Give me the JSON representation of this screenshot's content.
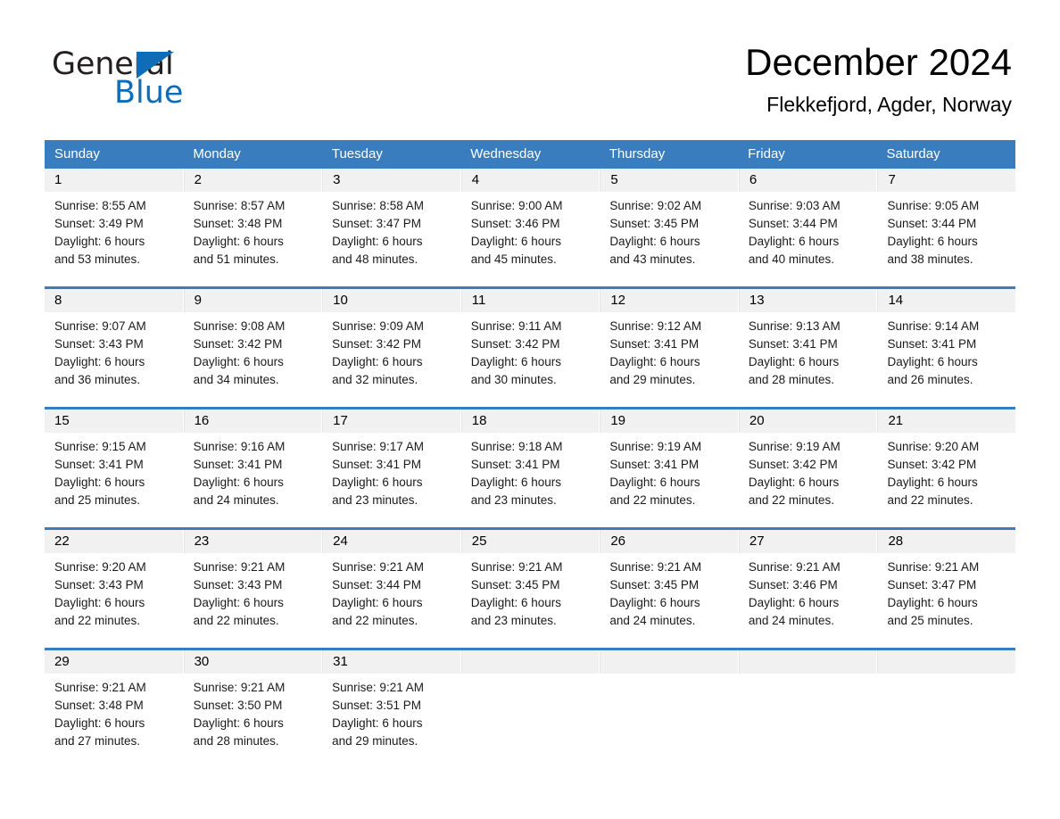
{
  "logo": {
    "word_one": "General",
    "word_two": "Blue",
    "triangle_icon": "triangle-icon",
    "brand_blue": "#0f6cb5"
  },
  "header": {
    "title": "December 2024",
    "subtitle": "Flekkefjord, Agder, Norway"
  },
  "colors": {
    "header_blue": "#3a7dbe",
    "day_band_gray": "#f1f1f1",
    "text_black": "#000000"
  },
  "weekdays": [
    "Sunday",
    "Monday",
    "Tuesday",
    "Wednesday",
    "Thursday",
    "Friday",
    "Saturday"
  ],
  "weeks": [
    {
      "days": [
        {
          "date": "1",
          "sunrise": "Sunrise: 8:55 AM",
          "sunset": "Sunset: 3:49 PM",
          "daylight_line1": "Daylight: 6 hours",
          "daylight_line2": "and 53 minutes."
        },
        {
          "date": "2",
          "sunrise": "Sunrise: 8:57 AM",
          "sunset": "Sunset: 3:48 PM",
          "daylight_line1": "Daylight: 6 hours",
          "daylight_line2": "and 51 minutes."
        },
        {
          "date": "3",
          "sunrise": "Sunrise: 8:58 AM",
          "sunset": "Sunset: 3:47 PM",
          "daylight_line1": "Daylight: 6 hours",
          "daylight_line2": "and 48 minutes."
        },
        {
          "date": "4",
          "sunrise": "Sunrise: 9:00 AM",
          "sunset": "Sunset: 3:46 PM",
          "daylight_line1": "Daylight: 6 hours",
          "daylight_line2": "and 45 minutes."
        },
        {
          "date": "5",
          "sunrise": "Sunrise: 9:02 AM",
          "sunset": "Sunset: 3:45 PM",
          "daylight_line1": "Daylight: 6 hours",
          "daylight_line2": "and 43 minutes."
        },
        {
          "date": "6",
          "sunrise": "Sunrise: 9:03 AM",
          "sunset": "Sunset: 3:44 PM",
          "daylight_line1": "Daylight: 6 hours",
          "daylight_line2": "and 40 minutes."
        },
        {
          "date": "7",
          "sunrise": "Sunrise: 9:05 AM",
          "sunset": "Sunset: 3:44 PM",
          "daylight_line1": "Daylight: 6 hours",
          "daylight_line2": "and 38 minutes."
        }
      ]
    },
    {
      "days": [
        {
          "date": "8",
          "sunrise": "Sunrise: 9:07 AM",
          "sunset": "Sunset: 3:43 PM",
          "daylight_line1": "Daylight: 6 hours",
          "daylight_line2": "and 36 minutes."
        },
        {
          "date": "9",
          "sunrise": "Sunrise: 9:08 AM",
          "sunset": "Sunset: 3:42 PM",
          "daylight_line1": "Daylight: 6 hours",
          "daylight_line2": "and 34 minutes."
        },
        {
          "date": "10",
          "sunrise": "Sunrise: 9:09 AM",
          "sunset": "Sunset: 3:42 PM",
          "daylight_line1": "Daylight: 6 hours",
          "daylight_line2": "and 32 minutes."
        },
        {
          "date": "11",
          "sunrise": "Sunrise: 9:11 AM",
          "sunset": "Sunset: 3:42 PM",
          "daylight_line1": "Daylight: 6 hours",
          "daylight_line2": "and 30 minutes."
        },
        {
          "date": "12",
          "sunrise": "Sunrise: 9:12 AM",
          "sunset": "Sunset: 3:41 PM",
          "daylight_line1": "Daylight: 6 hours",
          "daylight_line2": "and 29 minutes."
        },
        {
          "date": "13",
          "sunrise": "Sunrise: 9:13 AM",
          "sunset": "Sunset: 3:41 PM",
          "daylight_line1": "Daylight: 6 hours",
          "daylight_line2": "and 28 minutes."
        },
        {
          "date": "14",
          "sunrise": "Sunrise: 9:14 AM",
          "sunset": "Sunset: 3:41 PM",
          "daylight_line1": "Daylight: 6 hours",
          "daylight_line2": "and 26 minutes."
        }
      ]
    },
    {
      "days": [
        {
          "date": "15",
          "sunrise": "Sunrise: 9:15 AM",
          "sunset": "Sunset: 3:41 PM",
          "daylight_line1": "Daylight: 6 hours",
          "daylight_line2": "and 25 minutes."
        },
        {
          "date": "16",
          "sunrise": "Sunrise: 9:16 AM",
          "sunset": "Sunset: 3:41 PM",
          "daylight_line1": "Daylight: 6 hours",
          "daylight_line2": "and 24 minutes."
        },
        {
          "date": "17",
          "sunrise": "Sunrise: 9:17 AM",
          "sunset": "Sunset: 3:41 PM",
          "daylight_line1": "Daylight: 6 hours",
          "daylight_line2": "and 23 minutes."
        },
        {
          "date": "18",
          "sunrise": "Sunrise: 9:18 AM",
          "sunset": "Sunset: 3:41 PM",
          "daylight_line1": "Daylight: 6 hours",
          "daylight_line2": "and 23 minutes."
        },
        {
          "date": "19",
          "sunrise": "Sunrise: 9:19 AM",
          "sunset": "Sunset: 3:41 PM",
          "daylight_line1": "Daylight: 6 hours",
          "daylight_line2": "and 22 minutes."
        },
        {
          "date": "20",
          "sunrise": "Sunrise: 9:19 AM",
          "sunset": "Sunset: 3:42 PM",
          "daylight_line1": "Daylight: 6 hours",
          "daylight_line2": "and 22 minutes."
        },
        {
          "date": "21",
          "sunrise": "Sunrise: 9:20 AM",
          "sunset": "Sunset: 3:42 PM",
          "daylight_line1": "Daylight: 6 hours",
          "daylight_line2": "and 22 minutes."
        }
      ]
    },
    {
      "days": [
        {
          "date": "22",
          "sunrise": "Sunrise: 9:20 AM",
          "sunset": "Sunset: 3:43 PM",
          "daylight_line1": "Daylight: 6 hours",
          "daylight_line2": "and 22 minutes."
        },
        {
          "date": "23",
          "sunrise": "Sunrise: 9:21 AM",
          "sunset": "Sunset: 3:43 PM",
          "daylight_line1": "Daylight: 6 hours",
          "daylight_line2": "and 22 minutes."
        },
        {
          "date": "24",
          "sunrise": "Sunrise: 9:21 AM",
          "sunset": "Sunset: 3:44 PM",
          "daylight_line1": "Daylight: 6 hours",
          "daylight_line2": "and 22 minutes."
        },
        {
          "date": "25",
          "sunrise": "Sunrise: 9:21 AM",
          "sunset": "Sunset: 3:45 PM",
          "daylight_line1": "Daylight: 6 hours",
          "daylight_line2": "and 23 minutes."
        },
        {
          "date": "26",
          "sunrise": "Sunrise: 9:21 AM",
          "sunset": "Sunset: 3:45 PM",
          "daylight_line1": "Daylight: 6 hours",
          "daylight_line2": "and 24 minutes."
        },
        {
          "date": "27",
          "sunrise": "Sunrise: 9:21 AM",
          "sunset": "Sunset: 3:46 PM",
          "daylight_line1": "Daylight: 6 hours",
          "daylight_line2": "and 24 minutes."
        },
        {
          "date": "28",
          "sunrise": "Sunrise: 9:21 AM",
          "sunset": "Sunset: 3:47 PM",
          "daylight_line1": "Daylight: 6 hours",
          "daylight_line2": "and 25 minutes."
        }
      ]
    },
    {
      "days": [
        {
          "date": "29",
          "sunrise": "Sunrise: 9:21 AM",
          "sunset": "Sunset: 3:48 PM",
          "daylight_line1": "Daylight: 6 hours",
          "daylight_line2": "and 27 minutes."
        },
        {
          "date": "30",
          "sunrise": "Sunrise: 9:21 AM",
          "sunset": "Sunset: 3:50 PM",
          "daylight_line1": "Daylight: 6 hours",
          "daylight_line2": "and 28 minutes."
        },
        {
          "date": "31",
          "sunrise": "Sunrise: 9:21 AM",
          "sunset": "Sunset: 3:51 PM",
          "daylight_line1": "Daylight: 6 hours",
          "daylight_line2": "and 29 minutes."
        },
        {
          "date": "",
          "sunrise": "",
          "sunset": "",
          "daylight_line1": "",
          "daylight_line2": ""
        },
        {
          "date": "",
          "sunrise": "",
          "sunset": "",
          "daylight_line1": "",
          "daylight_line2": ""
        },
        {
          "date": "",
          "sunrise": "",
          "sunset": "",
          "daylight_line1": "",
          "daylight_line2": ""
        },
        {
          "date": "",
          "sunrise": "",
          "sunset": "",
          "daylight_line1": "",
          "daylight_line2": ""
        }
      ]
    }
  ]
}
